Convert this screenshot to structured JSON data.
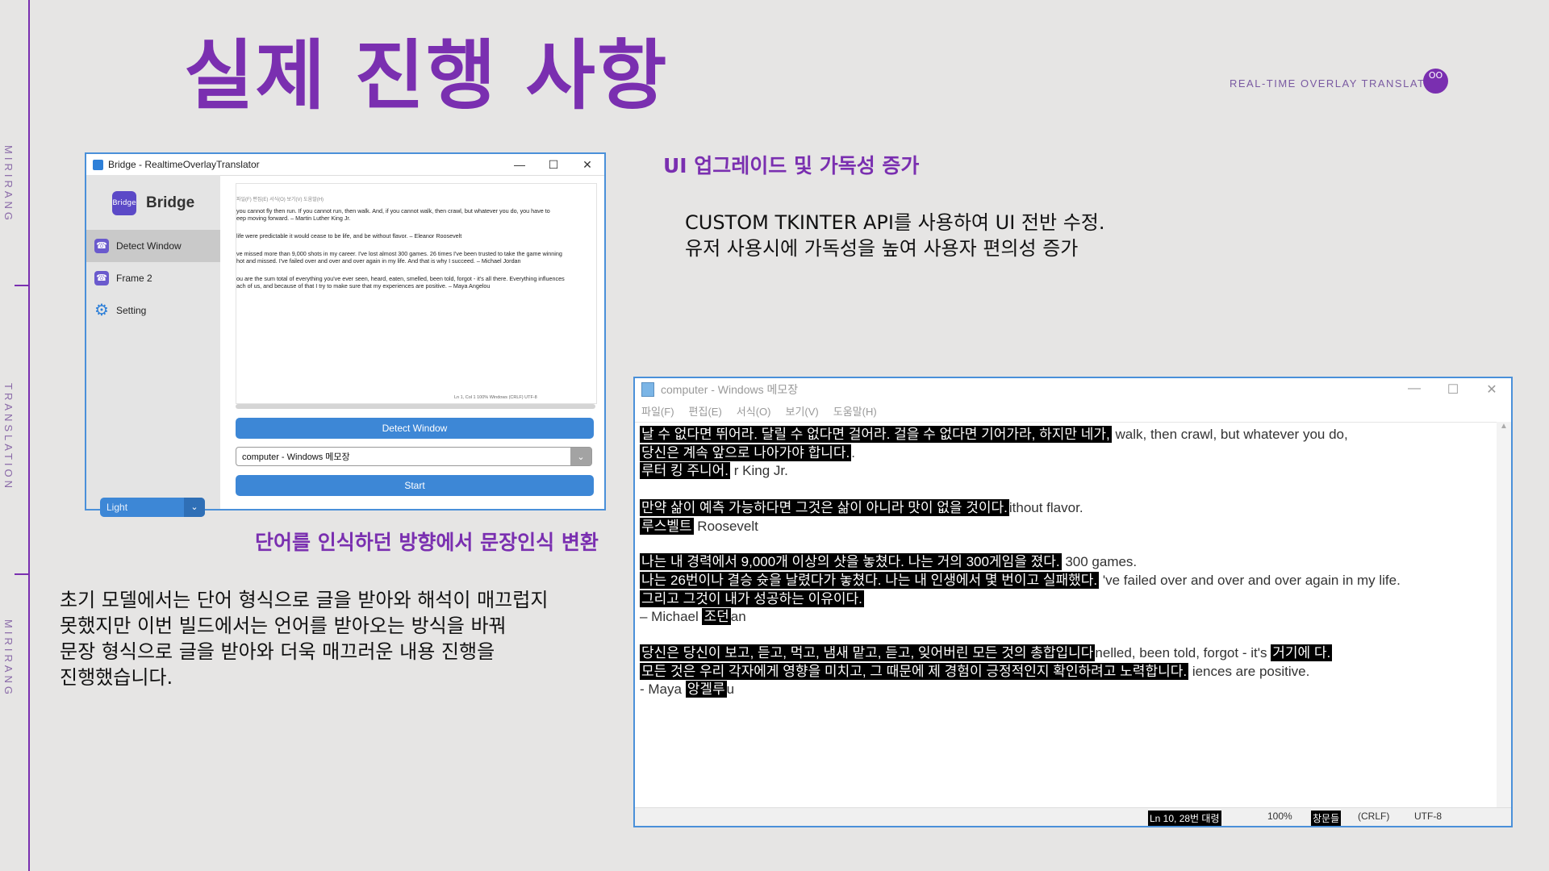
{
  "sidebar_labels": [
    "MIRIRANG",
    "TRANSLATION",
    "MIRIRANG"
  ],
  "page_title": "실제 진행 사항",
  "brand": {
    "tag": "REAL-TIME OVERLAY TRANSLATION",
    "logo_text": "OO"
  },
  "bridge_window": {
    "title": "Bridge - RealtimeOverlayTranslator",
    "controls": [
      "—",
      "☐",
      "✕"
    ],
    "app_name": "Bridge",
    "logo_text": "Bridge",
    "nav": [
      {
        "label": "Detect Window",
        "icon": "phone-icon"
      },
      {
        "label": "Frame 2",
        "icon": "phone-icon"
      },
      {
        "label": "Setting",
        "icon": "gear-icon"
      }
    ],
    "theme_value": "Light",
    "preview_menu": "파일(F)   편집(E)   서식(O)   보기(V)   도움말(H)",
    "preview_lines": [
      "you cannot fly then run. If you cannot run, then walk. And, if you cannot walk, then crawl, but whatever you do, you have to",
      "eep moving forward. – Martin Luther King Jr.",
      "life were predictable it would cease to be life, and be without flavor. – Eleanor Roosevelt",
      "ve missed more than 9,000 shots in my career. I've lost almost 300 games. 26 times I've been trusted to take the game winning",
      "hot and missed. I've failed over and over and over again in my life. And that is why I succeed. – Michael Jordan",
      "ou are the sum total of everything you've ever seen, heard, eaten, smelled, been told, forgot - it's all there. Everything influences",
      "ach of us, and because of that I try to make sure that my experiences are positive. – Maya Angelou"
    ],
    "preview_status": "Ln 1, Col 1          100%    Windows (CRLF)     UTF-8",
    "detect_button": "Detect Window",
    "window_select_value": "computer - Windows 메모장",
    "start_button": "Start"
  },
  "left_heading": "단어를 인식하던 방향에서 문장인식 변환",
  "left_body": [
    "초기 모델에서는 단어 형식으로 글을 받아와 해석이 매끄럽지",
    "못했지만 이번 빌드에서는 언어를 받아오는 방식을 바꿔",
    "문장 형식으로 글을 받아와 더욱 매끄러운 내용 진행을",
    "진행했습니다."
  ],
  "right_heading": "UI 업그레이드 및 가독성 증가",
  "right_body": [
    "CUSTOM TKINTER API를 사용하여 UI 전반 수정.",
    "유저 사용시에 가독성을 높여 사용자 편의성 증가"
  ],
  "notepad": {
    "title": "computer - Windows 메모장",
    "controls": [
      "—",
      "☐",
      "✕"
    ],
    "menu": [
      "파일(F)",
      "편집(E)",
      "서식(O)",
      "보기(V)",
      "도움말(H)"
    ],
    "rows": [
      {
        "overlay": "날 수 없다면 뛰어라. 달릴 수 없다면 걸어라. 걸을 수 없다면 기어가라, 하지만 네가,",
        "text": " walk, then crawl, but whatever you do,"
      },
      {
        "overlay": "당신은 계속 앞으로 나아가야 합니다.",
        "text": "."
      },
      {
        "overlay": "루터 킹 주니어.",
        "text": " r King Jr."
      },
      {
        "overlay": "만약 삶이 예측 가능하다면 그것은 삶이 아니라 맛이 없을 것이다.",
        "text": "ithout flavor."
      },
      {
        "overlay": "루스벨트",
        "text": " Roosevelt"
      },
      {
        "overlay": "나는 내 경력에서 9,000개 이상의 샷을 놓쳤다. 나는 거의 300게임을 졌다.",
        "text": " 300 games."
      },
      {
        "overlay": "나는 26번이나 결승 슛을 날렸다가 놓쳤다. 나는 내 인생에서 몇 번이고 실패했다.",
        "text": " 've failed over and over and over again in my life."
      },
      {
        "overlay": "그리고 그것이 내가 성공하는 이유이다.",
        "text": ""
      },
      {
        "prefix": "– Michael ",
        "overlay": "조던",
        "text": "an"
      },
      {
        "overlay": "당신은 당신이 보고, 듣고, 먹고, 냄새 맡고, 듣고, 잊어버린 모든 것의 총합입니다",
        "text": "nelled, been told, forgot - it's ",
        "overlay2": "거기에 다."
      },
      {
        "overlay": "모든 것은 우리 각자에게 영향을 미치고, 그 때문에 제 경험이 긍정적인지 확인하려고 노력합니다.",
        "text": " iences are positive."
      },
      {
        "prefix": "- Maya ",
        "overlay": "앙겔루",
        "text": "u"
      }
    ],
    "status": {
      "position": "Ln 10, 28번 대령",
      "zoom": "100%",
      "line_ending_overlay": "창문들",
      "line_ending": "(CRLF)",
      "encoding": "UTF-8"
    }
  }
}
